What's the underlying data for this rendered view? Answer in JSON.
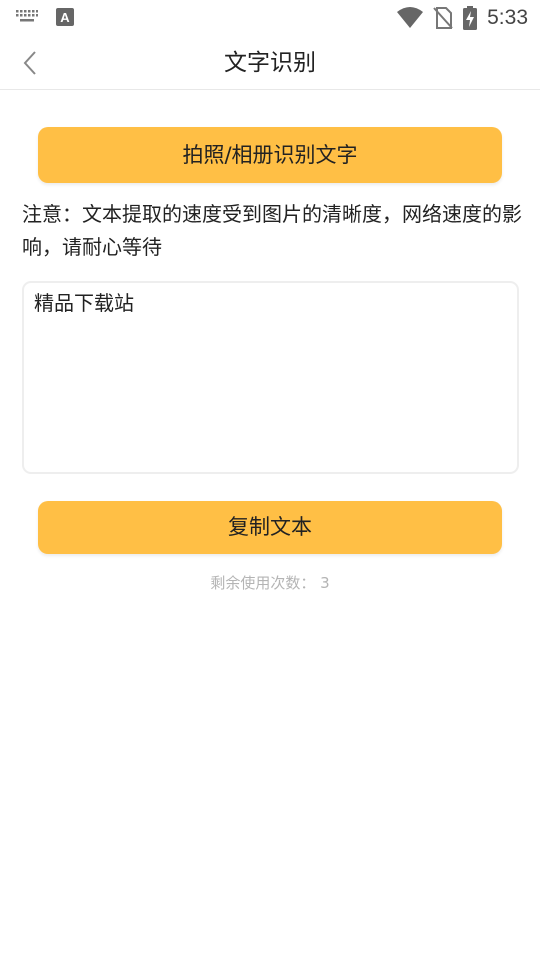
{
  "status_bar": {
    "time": "5:33",
    "icons": [
      "keyboard-icon",
      "font-notification-icon",
      "wifi-icon",
      "no-sim-icon",
      "battery-charging-icon"
    ]
  },
  "nav": {
    "back_icon": "chevron-left-icon",
    "title": "文字识别"
  },
  "ocr_button": {
    "label": "拍照/相册识别文字"
  },
  "notice": "注意：文本提取的速度受到图片的清晰度，网络速度的影响，请耐心等待",
  "result_text": "精品下载站",
  "copy_button": {
    "label": "复制文本"
  },
  "remaining": "剩余使用次数：  3",
  "colors": {
    "accent": "#ffbf45",
    "muted_text": "#b4b4b4",
    "divider": "#e8e8e8"
  }
}
